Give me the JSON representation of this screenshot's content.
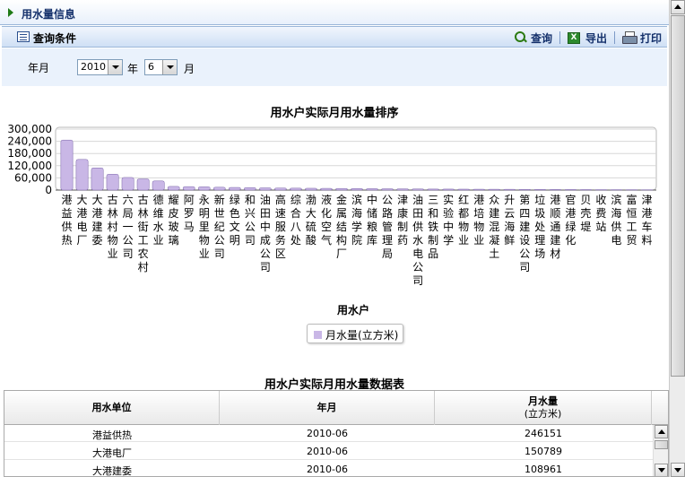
{
  "page": {
    "title": "用水量信息"
  },
  "query": {
    "section_title": "查询条件",
    "toolbar": {
      "search_label": "查询",
      "export_label": "导出",
      "print_label": "打印"
    },
    "year_month_label": "年月",
    "year_value": "2010",
    "year_unit": "年",
    "month_value": "6",
    "month_unit": "月"
  },
  "chart_data": {
    "type": "bar",
    "title": "用水户实际月用水量排序",
    "xlabel": "用水户",
    "ylabel": "",
    "ylim": [
      0,
      300000
    ],
    "yticks": [
      "300,000",
      "240,000",
      "180,000",
      "120,000",
      "60,000",
      "0"
    ],
    "legend": "bottom",
    "grid": true,
    "series": [
      {
        "name": "月水量(立方米)",
        "color": "#c9b7e6",
        "values": [
          246151,
          150789,
          108961,
          78000,
          62000,
          55000,
          45000,
          18000,
          17000,
          16000,
          14000,
          13000,
          12000,
          11000,
          10000,
          9500,
          9000,
          8500,
          8000,
          7500,
          7000,
          6500,
          6000,
          5500,
          5000,
          4800,
          4500,
          4200,
          4000,
          3800,
          3500,
          3200,
          3000,
          2800,
          2500,
          2200,
          2000,
          1800,
          1500,
          1200,
          1000,
          800,
          500,
          300
        ]
      }
    ],
    "categories": [
      "港益供热",
      "大港电厂",
      "大港建委",
      "古林村物业",
      "六局一公司",
      "古林街工农村",
      "德维水业",
      "耀皮玻璃",
      "阿罗马",
      "永明里物业",
      "新世纪公司",
      "绿色文明",
      "和兴公司",
      "油田中成公司",
      "高速服务区",
      "综合八处",
      "渤大硫酸",
      "液化空气",
      "金属结构厂",
      "滨海学院",
      "中储粮库",
      "公路管理局",
      "津康制药",
      "油田供水电公司",
      "三和铁制品",
      "实验中学",
      "红都物业",
      "港培物业",
      "众建混凝土",
      "升云海鲜",
      "第四建设公司",
      "垃圾处理场",
      "港顺通建材",
      "官港绿化",
      "贝壳堤",
      "收费站",
      "滨海供电",
      "富恒工贸",
      "津港车料"
    ]
  },
  "table": {
    "title": "用水户实际月用水量数据表",
    "headers": {
      "unit": "用水单位",
      "month": "年月",
      "volume": "月水量",
      "volume_unit": "(立方米)"
    },
    "rows": [
      {
        "unit": "港益供热",
        "month": "2010-06",
        "volume": "246151"
      },
      {
        "unit": "大港电厂",
        "month": "2010-06",
        "volume": "150789"
      },
      {
        "unit": "大港建委",
        "month": "2010-06",
        "volume": "108961"
      }
    ]
  }
}
